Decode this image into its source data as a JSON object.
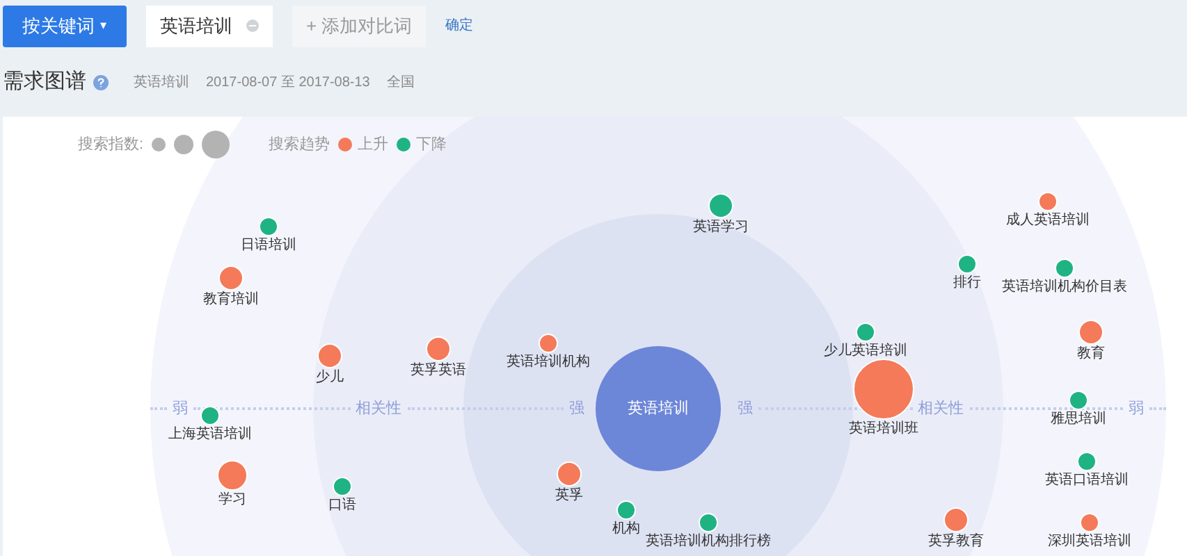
{
  "toolbar": {
    "mode_button": "按关键词",
    "caret": "▾",
    "keyword": "英语培训",
    "add_button": "+ 添加对比词",
    "confirm_link": "确定"
  },
  "header": {
    "title": "需求图谱",
    "keyword": "英语培训",
    "date_range": "2017-08-07 至 2017-08-13",
    "region": "全国"
  },
  "legend": {
    "size_label": "搜索指数:",
    "trend_label": "搜索趋势",
    "trends": [
      {
        "label": "上升",
        "color": "#f47a5a"
      },
      {
        "label": "下降",
        "color": "#1fb384"
      }
    ]
  },
  "graph": {
    "center": "英语培训",
    "axis_left": [
      "弱",
      "相关性",
      "强"
    ],
    "axis_right": [
      "强",
      "相关性",
      "弱"
    ],
    "nodes": [
      {
        "label": "成人英语培训",
        "kind": "small",
        "color": "#f47a5a"
      },
      {
        "label": "英语学习",
        "kind": "medium",
        "color": "#1fb384"
      },
      {
        "label": "日语培训",
        "kind": "small",
        "color": "#1fb384"
      },
      {
        "label": "排行",
        "kind": "small",
        "color": "#1fb384"
      },
      {
        "label": "英语培训机构价目表",
        "kind": "small",
        "color": "#1fb384"
      },
      {
        "label": "教育培训",
        "kind": "medium",
        "color": "#f47a5a"
      },
      {
        "label": "少儿英语培训",
        "kind": "small",
        "color": "#1fb384"
      },
      {
        "label": "教育",
        "kind": "medium",
        "color": "#f47a5a"
      },
      {
        "label": "英语培训机构",
        "kind": "small",
        "color": "#f47a5a"
      },
      {
        "label": "英孚英语",
        "kind": "medium",
        "color": "#f47a5a"
      },
      {
        "label": "少儿",
        "kind": "medium",
        "color": "#f47a5a"
      },
      {
        "label": "英语培训班",
        "kind": "huge",
        "color": "#f47a5a"
      },
      {
        "label": "雅思培训",
        "kind": "small",
        "color": "#1fb384"
      },
      {
        "label": "上海英语培训",
        "kind": "small",
        "color": "#1fb384"
      },
      {
        "label": "英语口语培训",
        "kind": "small",
        "color": "#1fb384"
      },
      {
        "label": "英孚",
        "kind": "medium",
        "color": "#f47a5a"
      },
      {
        "label": "学习",
        "kind": "large",
        "color": "#f47a5a"
      },
      {
        "label": "口语",
        "kind": "small",
        "color": "#1fb384"
      },
      {
        "label": "机构",
        "kind": "small",
        "color": "#1fb384"
      },
      {
        "label": "英语培训机构排行榜",
        "kind": "small",
        "color": "#1fb384"
      },
      {
        "label": "英孚教育",
        "kind": "medium",
        "color": "#f47a5a"
      },
      {
        "label": "深圳英语培训",
        "kind": "small",
        "color": "#f47a5a"
      }
    ]
  }
}
